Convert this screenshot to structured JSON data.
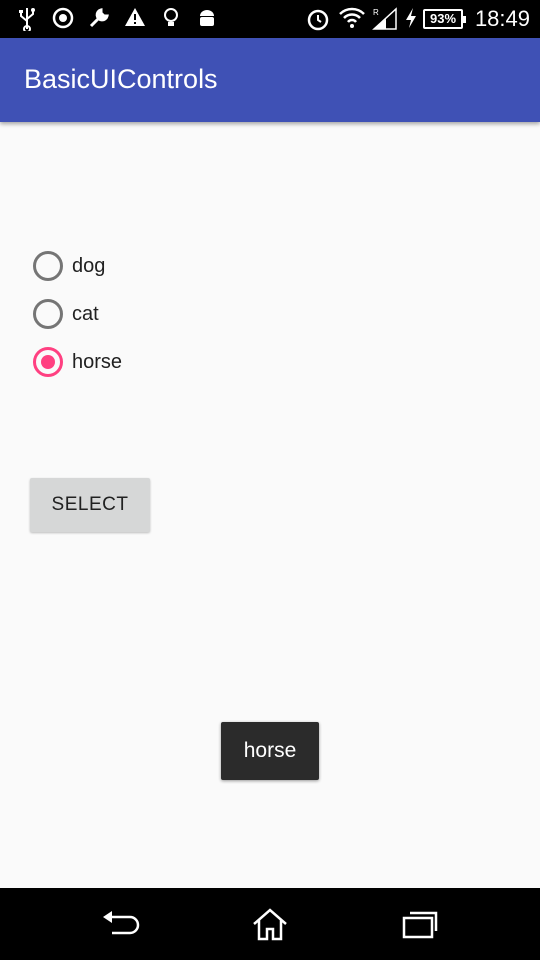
{
  "status_bar": {
    "time": "18:49",
    "battery": "93%",
    "icons": [
      "usb-icon",
      "sync-icon",
      "wrench-icon",
      "warning-icon",
      "bulb-icon",
      "android-icon",
      "alarm-icon",
      "wifi-icon",
      "signal-icon",
      "charging-icon",
      "battery-icon"
    ]
  },
  "app_bar": {
    "title": "BasicUIControls",
    "color": "#3f51b5"
  },
  "radio_group": {
    "options": [
      {
        "label": "dog",
        "checked": false
      },
      {
        "label": "cat",
        "checked": false
      },
      {
        "label": "horse",
        "checked": true
      }
    ],
    "accent": "#ff4081"
  },
  "select_button": {
    "label": "SELECT"
  },
  "toast": {
    "text": "horse"
  },
  "nav_bar": {
    "icons": [
      "back-icon",
      "home-icon",
      "recents-icon"
    ]
  }
}
